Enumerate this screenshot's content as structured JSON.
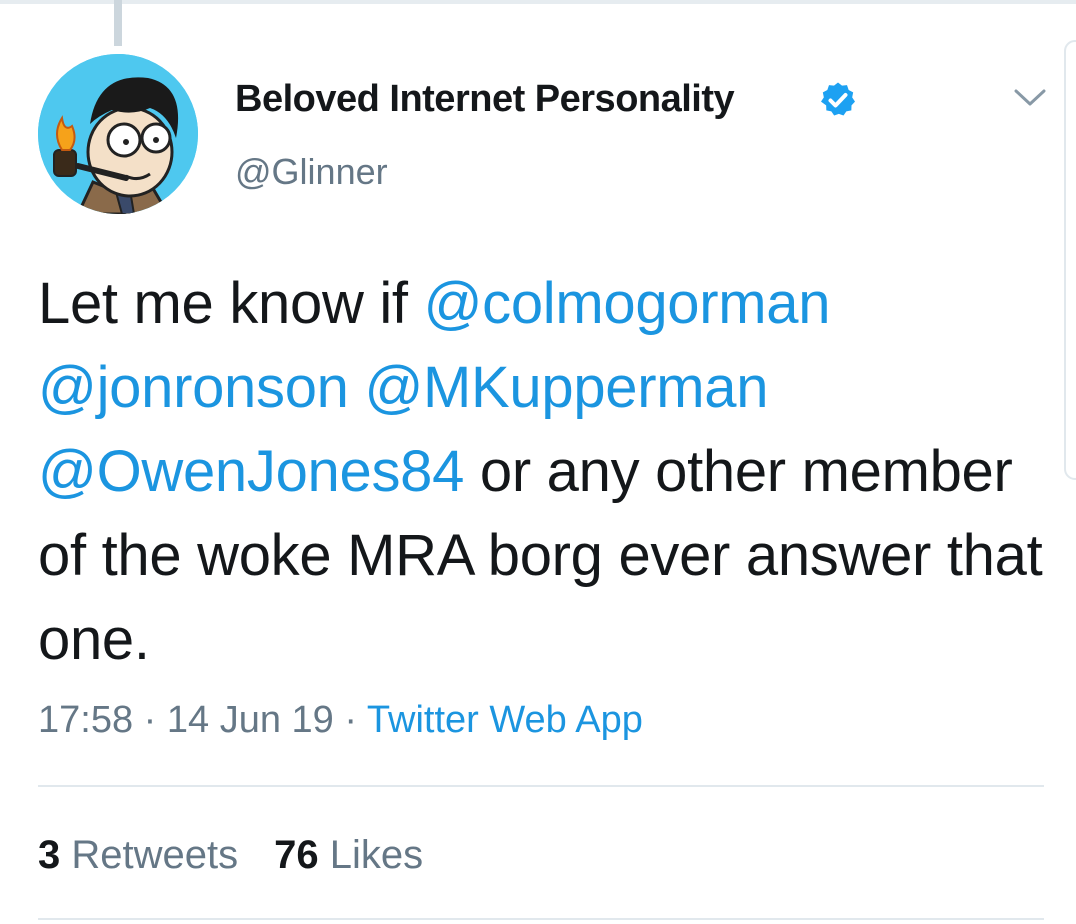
{
  "tweet": {
    "author": {
      "display_name": "Beloved Internet Personality",
      "handle": "@Glinner",
      "verified": true,
      "avatar_icon": "cartoon-avatar-with-pipe"
    },
    "text": {
      "lead": "Let me know if ",
      "mentions": [
        "@colmogorman",
        "@jonronson",
        "@MKupperman",
        "@OwenJones84"
      ],
      "tail": " or any other member of the woke MRA borg ever answer that one."
    },
    "time": "17:58",
    "sep": " · ",
    "date": "14 Jun 19",
    "source": "Twitter Web App",
    "stats": {
      "retweets_count": "3",
      "retweets_label": "Retweets",
      "likes_count": "76",
      "likes_label": "Likes"
    },
    "menu_icon": "chevron-down-icon"
  },
  "colors": {
    "link": "#1b95e0",
    "text": "#14171a",
    "muted": "#657786",
    "verified": "#1da1f2"
  }
}
